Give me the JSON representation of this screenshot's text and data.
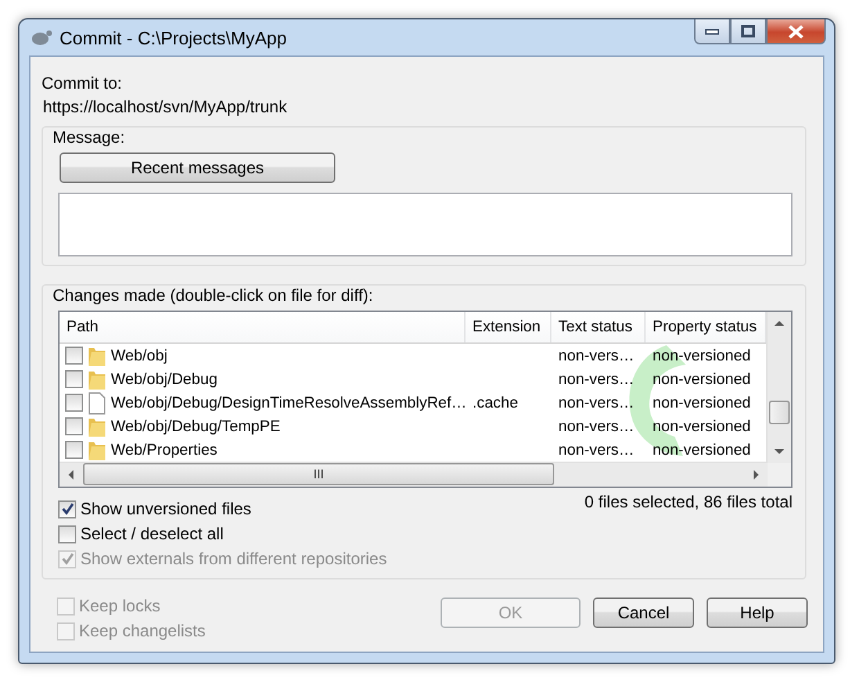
{
  "window": {
    "title": "Commit - C:\\Projects\\MyApp"
  },
  "commit_to": {
    "label": "Commit to:",
    "url": "https://localhost/svn/MyApp/trunk"
  },
  "message": {
    "label": "Message:",
    "recent_button": "Recent messages"
  },
  "changes": {
    "label": "Changes made (double-click on file for diff):",
    "columns": [
      "Path",
      "Extension",
      "Text status",
      "Property status"
    ],
    "rows": [
      {
        "kind": "folder",
        "checked": false,
        "path": "Web/obj",
        "text_status": "non-vers…",
        "property_status": "non-versioned"
      },
      {
        "kind": "folder",
        "checked": false,
        "path": "Web/obj/Debug",
        "text_status": "non-vers…",
        "property_status": "non-versioned"
      },
      {
        "kind": "file",
        "checked": false,
        "path": "Web/obj/Debug/DesignTimeResolveAssemblyRef…",
        "extension": ".cache",
        "text_status": "non-vers…",
        "property_status": "non-versioned"
      },
      {
        "kind": "folder",
        "checked": false,
        "path": "Web/obj/Debug/TempPE",
        "text_status": "non-vers…",
        "property_status": "non-versioned"
      },
      {
        "kind": "folder",
        "checked": false,
        "path": "Web/Properties",
        "text_status": "non-vers…",
        "property_status": "non-versioned"
      }
    ],
    "scroll_grip": "III",
    "summary": "0 files selected, 86 files total",
    "options": [
      {
        "label": "Show unversioned files",
        "checked": true,
        "disabled": false
      },
      {
        "label": "Select / deselect all",
        "checked": false,
        "disabled": false
      },
      {
        "label": "Show externals from different repositories",
        "checked": true,
        "disabled": true
      }
    ]
  },
  "keep_options": [
    {
      "label": "Keep locks",
      "checked": false,
      "disabled": true
    },
    {
      "label": "Keep changelists",
      "checked": false,
      "disabled": true
    }
  ],
  "buttons": [
    {
      "label": "OK",
      "disabled": true
    },
    {
      "label": "Cancel",
      "disabled": false
    },
    {
      "label": "Help",
      "disabled": false
    }
  ]
}
